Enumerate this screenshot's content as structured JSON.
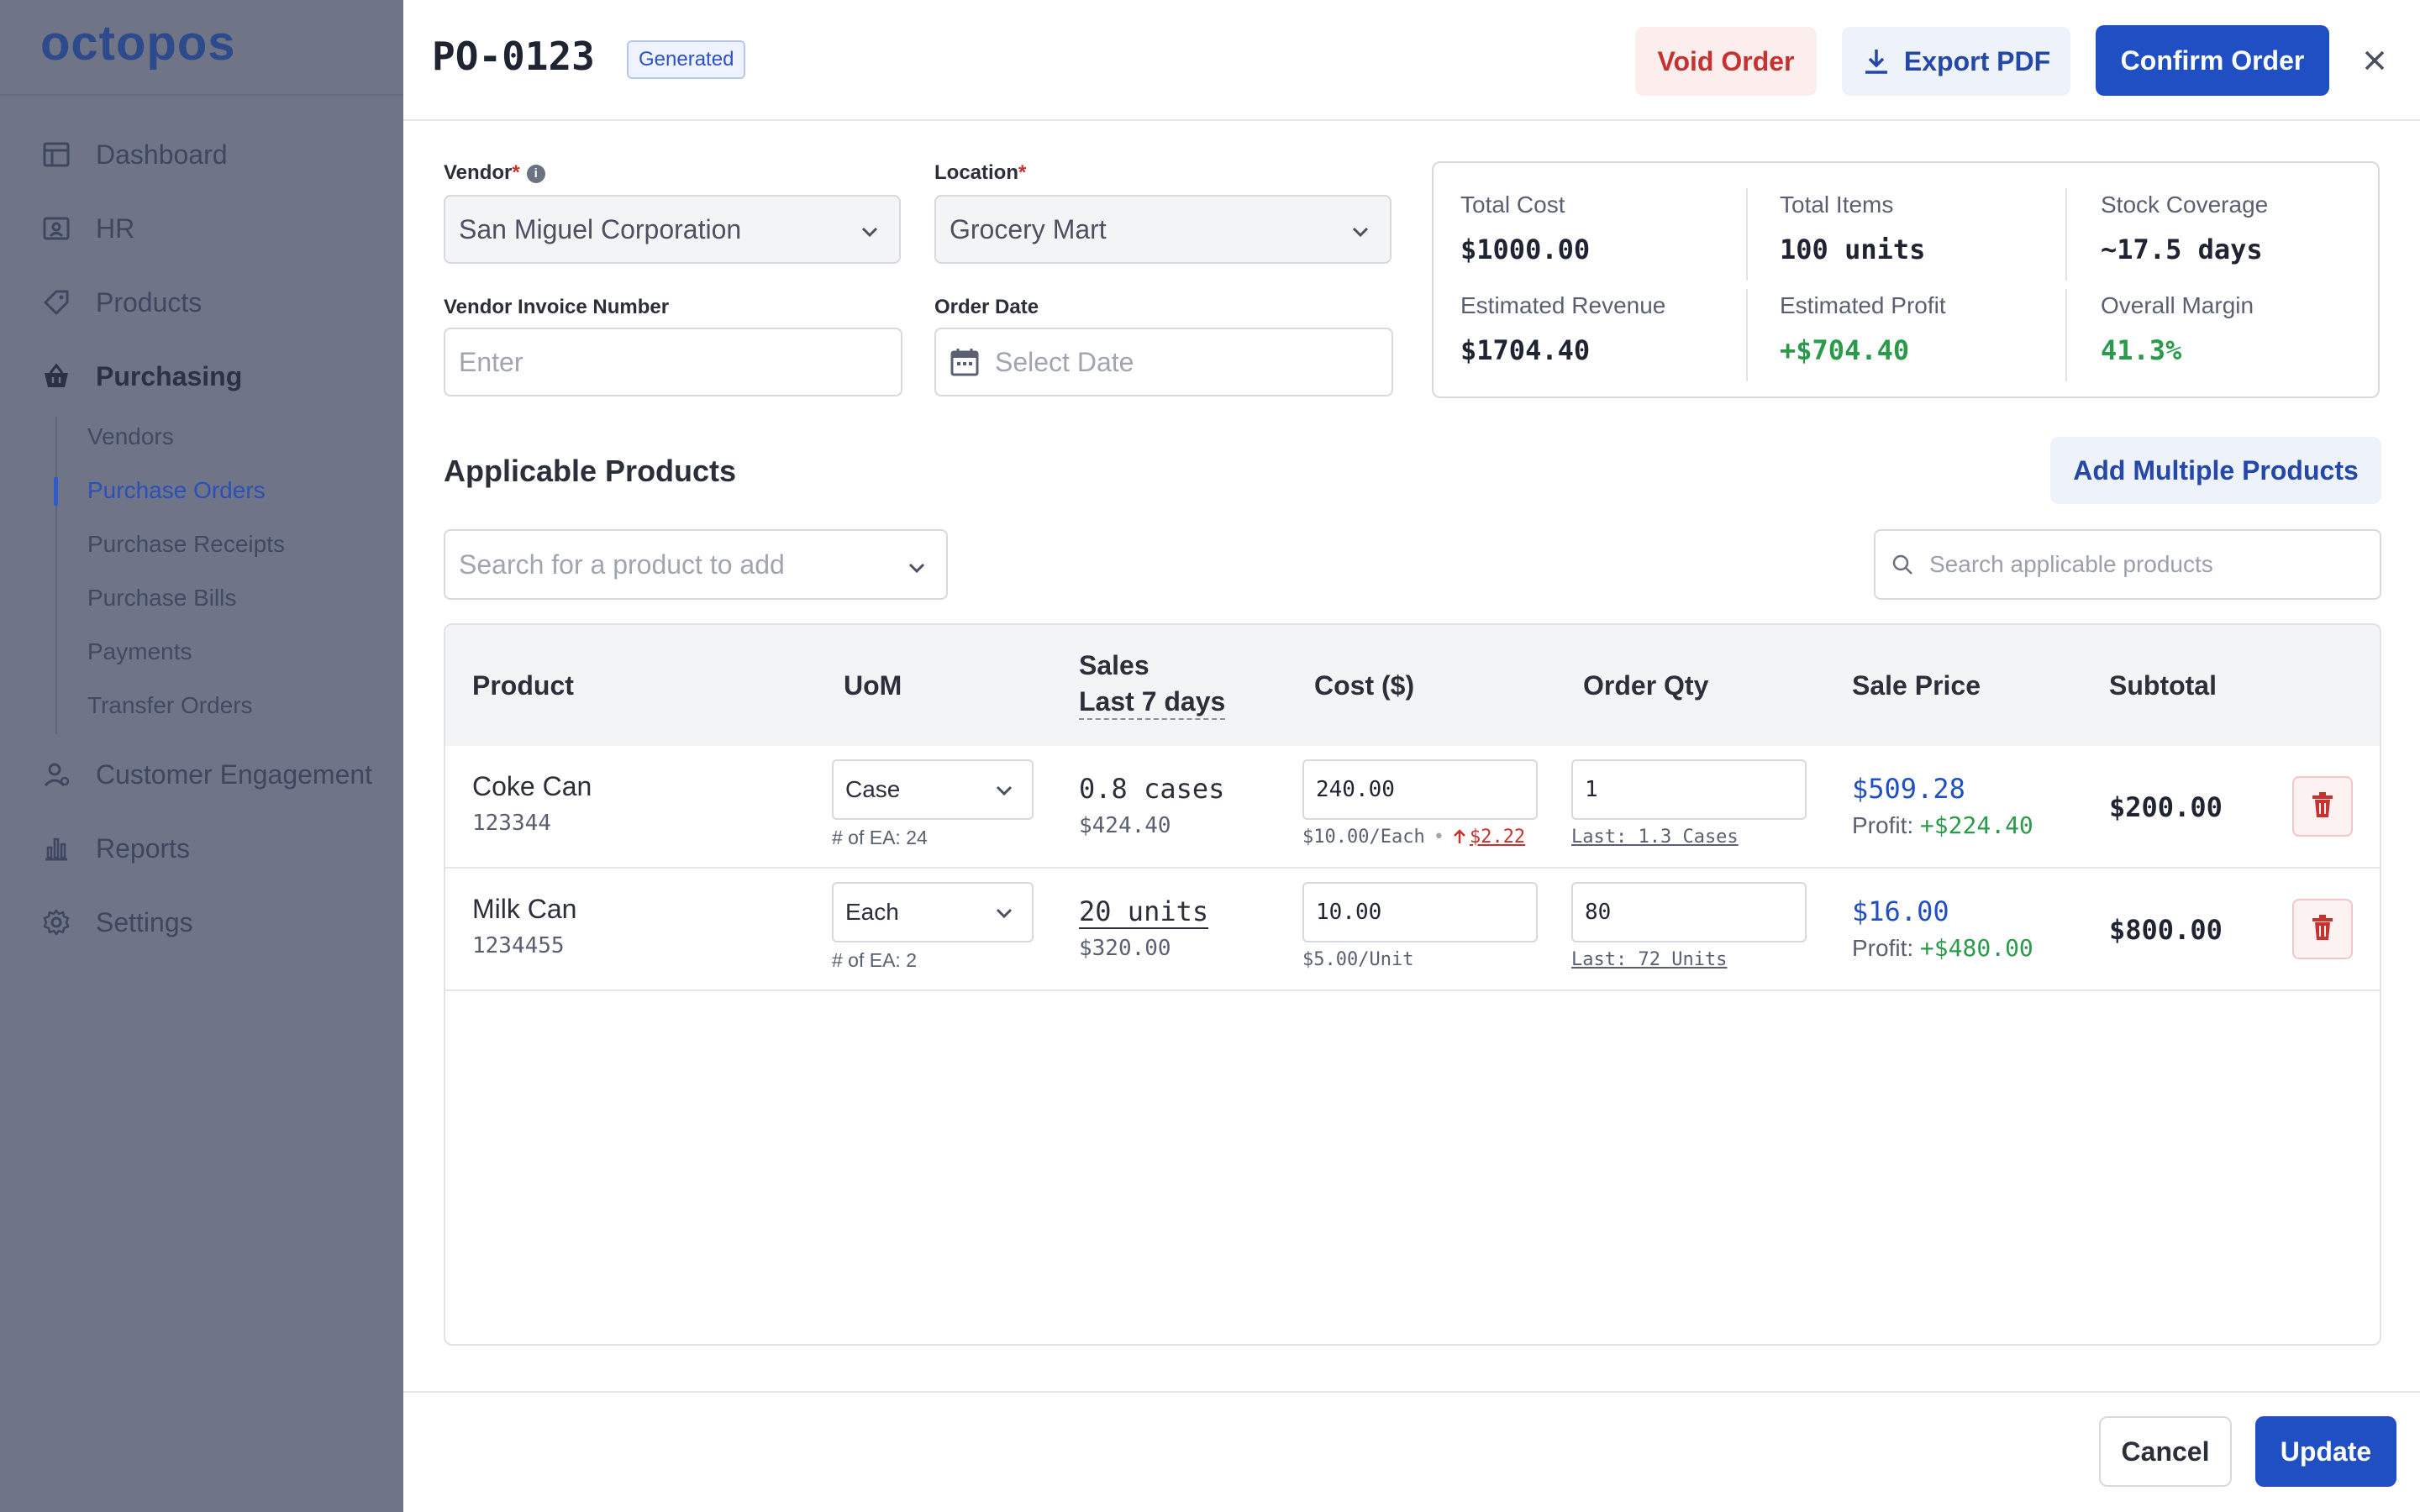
{
  "app": {
    "logo": "octopos"
  },
  "sidebar": {
    "items": [
      {
        "label": "Dashboard",
        "icon": "dashboard-icon"
      },
      {
        "label": "HR",
        "icon": "id-card-icon"
      },
      {
        "label": "Products",
        "icon": "tag-icon"
      },
      {
        "label": "Purchasing",
        "icon": "basket-icon"
      },
      {
        "label": "Customer Engagement",
        "icon": "user-icon"
      },
      {
        "label": "Reports",
        "icon": "bar-chart-icon"
      },
      {
        "label": "Settings",
        "icon": "gear-icon"
      }
    ],
    "purchasing_sub": [
      "Vendors",
      "Purchase Orders",
      "Purchase Receipts",
      "Purchase Bills",
      "Payments",
      "Transfer Orders"
    ],
    "active_sub": "Purchase Orders"
  },
  "header": {
    "po_number": "PO-0123",
    "status_badge": "Generated",
    "void_label": "Void Order",
    "export_label": "Export PDF",
    "confirm_label": "Confirm Order"
  },
  "form": {
    "vendor_label": "Vendor",
    "vendor_value": "San Miguel Corporation",
    "location_label": "Location",
    "location_value": "Grocery Mart",
    "invoice_label": "Vendor Invoice Number",
    "invoice_placeholder": "Enter",
    "date_label": "Order Date",
    "date_placeholder": "Select Date"
  },
  "stats": {
    "total_cost_label": "Total Cost",
    "total_cost": "$1000.00",
    "total_items_label": "Total Items",
    "total_items": "100 units",
    "coverage_label": "Stock Coverage",
    "coverage": "~17.5 days",
    "revenue_label": "Estimated Revenue",
    "revenue": "$1704.40",
    "profit_label": "Estimated Profit",
    "profit": "+$704.40",
    "margin_label": "Overall Margin",
    "margin": "41.3%"
  },
  "products": {
    "title": "Applicable Products",
    "add_multiple_label": "Add Multiple Products",
    "search_add_placeholder": "Search for a product to add",
    "search_applicable_placeholder": "Search applicable products",
    "columns": {
      "product": "Product",
      "uom": "UoM",
      "sales_line1": "Sales",
      "sales_line2": "Last 7 days",
      "cost": "Cost ($)",
      "order_qty": "Order Qty",
      "sale_price": "Sale Price",
      "subtotal": "Subtotal"
    },
    "rows": [
      {
        "name": "Coke Can",
        "sku": "123344",
        "uom": "Case",
        "ea": "# of EA: 24",
        "sales": "0.8 cases",
        "sales_value": "$424.40",
        "cost": "240.00",
        "cost_unit": "$10.00/Each",
        "cost_change": "$2.22",
        "qty": "1",
        "last": "Last: 1.3 Cases",
        "sale_price": "$509.28",
        "profit_label": "Profit:",
        "profit": "+$224.40",
        "subtotal": "$200.00"
      },
      {
        "name": "Milk Can",
        "sku": "1234455",
        "uom": "Each",
        "ea": "# of EA: 2",
        "sales": "20 units",
        "sales_value": "$320.00",
        "cost": "10.00",
        "cost_unit": "$5.00/Unit",
        "qty": "80",
        "last": "Last: 72 Units",
        "sale_price": "$16.00",
        "profit_label": "Profit:",
        "profit": "+$480.00",
        "subtotal": "$800.00"
      }
    ]
  },
  "footer": {
    "cancel_label": "Cancel",
    "update_label": "Update"
  },
  "colors": {
    "primary": "#1f4fc2",
    "danger": "#c5322f",
    "success": "#2b9a4b"
  }
}
